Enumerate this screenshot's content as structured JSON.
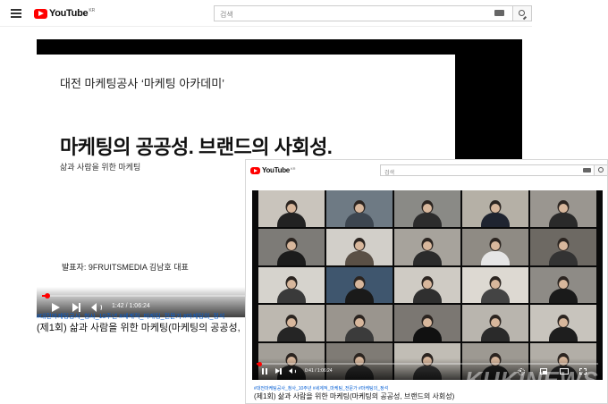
{
  "window1": {
    "logo_text": "YouTube",
    "logo_region": "KR",
    "search_placeholder": "검색",
    "slide": {
      "header": "대전 마케팅공사 ‘마케팅 아카데미’",
      "title": "마케팅의 공공성. 브랜드의 사회성.",
      "subtitle": "삶과 사람을 위한 마케팅",
      "presenter": "발표자: 9FRUITSMEDIA 김남호 대표"
    },
    "player": {
      "time": "1:42 / 1:06:24",
      "progress_fraction": 0.026
    },
    "tags": "#대전마케팅공사_청사_10주년 #세계적_마케팅_전문가 #마케팅의_정석",
    "video_title": "(제1회) 삶과 사람을 위한 마케팅(마케팅의 공공성,"
  },
  "window2": {
    "logo_text": "YouTube",
    "logo_region": "KR",
    "search_placeholder": "검색",
    "player": {
      "time": "0:41 / 1:06:24",
      "progress_fraction": 0.01
    },
    "tags": "#대전마케팅공사_청사_10주년 #세계적_마케팅_전문가 #마케팅의_정석",
    "video_title": "(제1회) 삶과 사람을 위한 마케팅(마케팅의 공공성, 브랜드의 사회성)"
  },
  "participants": [
    {
      "wall": "#c9c4bc",
      "body": "#222222"
    },
    {
      "wall": "#6e7a84",
      "body": "#3d4650"
    },
    {
      "wall": "#8a8a86",
      "body": "#2c2c2c"
    },
    {
      "wall": "#b5b0a6",
      "body": "#1f2430"
    },
    {
      "wall": "#9a9690",
      "body": "#2a2a2a"
    },
    {
      "wall": "#7d7b77",
      "body": "#1c1c1c"
    },
    {
      "wall": "#d2cfc9",
      "body": "#5a5046"
    },
    {
      "wall": "#a7a39c",
      "body": "#2b2b2b"
    },
    {
      "wall": "#8f8b84",
      "body": "#e6e6e6"
    },
    {
      "wall": "#6d6963",
      "body": "#333333"
    },
    {
      "wall": "#d6d3cd",
      "body": "#3a3a3a"
    },
    {
      "wall": "#3f566e",
      "body": "#1a1a1a"
    },
    {
      "wall": "#cfcbc4",
      "body": "#2f2f2f"
    },
    {
      "wall": "#ddd9d2",
      "body": "#444444"
    },
    {
      "wall": "#8e8b86",
      "body": "#1a1a1a"
    },
    {
      "wall": "#bdb8b0",
      "body": "#252525"
    },
    {
      "wall": "#9a958e",
      "body": "#3b3b3b"
    },
    {
      "wall": "#7b7772",
      "body": "#111111"
    },
    {
      "wall": "#b9b5ae",
      "body": "#2a2a2a"
    },
    {
      "wall": "#c8c4bd",
      "body": "#1e1e1e"
    },
    {
      "wall": "#a39f98",
      "body": "#222222"
    },
    {
      "wall": "#7f7b75",
      "body": "#2d2d2d"
    },
    {
      "wall": "#c1bdb5",
      "body": "#3a3a3a"
    },
    {
      "wall": "#9d9992",
      "body": "#1f1f1f"
    },
    {
      "wall": "#b2aea7",
      "body": "#2c2c2c"
    }
  ],
  "watermark": "KUKINEWS"
}
